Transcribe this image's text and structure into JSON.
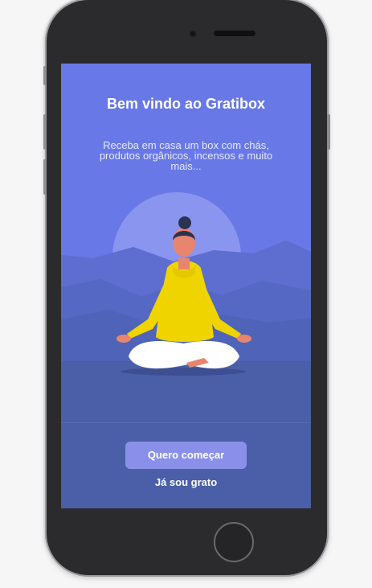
{
  "welcome": {
    "title": "Bem vindo ao Gratibox",
    "subtitle": "Receba em casa um box com chás, produtos orgânicos, incensos e muito mais..."
  },
  "actions": {
    "primary_label": "Quero começar",
    "secondary_label": "Já sou grato"
  },
  "illustration": {
    "name": "meditation-illustration"
  },
  "colors": {
    "sky": "#6878e6",
    "sun": "#8a95ef",
    "mountain_back": "#5d6dd0",
    "mountain_front": "#4f63b8",
    "ground": "#4a5fa8",
    "button": "#8a90ea",
    "hoodie": "#f0d400",
    "skin": "#e8856e"
  }
}
